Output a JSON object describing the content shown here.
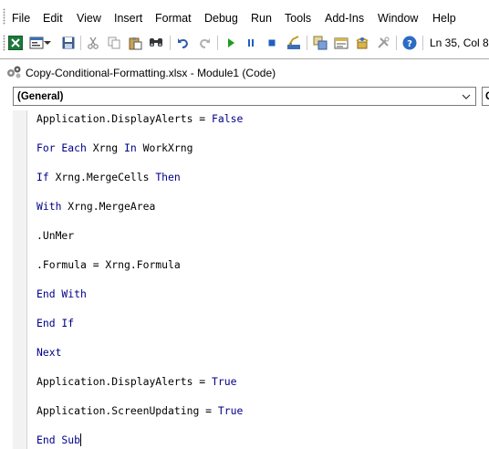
{
  "menu": [
    "File",
    "Edit",
    "View",
    "Insert",
    "Format",
    "Debug",
    "Run",
    "Tools",
    "Add-Ins",
    "Window",
    "Help"
  ],
  "toolbar": {
    "status": "Ln 35, Col 8",
    "icons": [
      "excel-icon",
      "insert-userform-icon",
      "dropdown-arrow-icon",
      "save-icon",
      "cut-icon",
      "copy-icon",
      "paste-icon",
      "find-icon",
      "undo-icon",
      "redo-icon",
      "run-icon",
      "break-icon",
      "reset-icon",
      "design-mode-icon",
      "project-explorer-icon",
      "properties-icon",
      "object-browser-icon",
      "toolbox-icon",
      "help-icon"
    ]
  },
  "window": {
    "title": "Copy-Conditional-Formatting.xlsx - Module1 (Code)",
    "object_combo": "(General)",
    "procedure_combo": "C"
  },
  "code": {
    "lines": [
      {
        "segments": [
          {
            "text": "Application.DisplayAlerts = ",
            "kw": false
          },
          {
            "text": "False",
            "kw": true
          }
        ]
      },
      {
        "segments": [
          {
            "text": "For Each",
            "kw": true
          },
          {
            "text": " Xrng ",
            "kw": false
          },
          {
            "text": "In",
            "kw": true
          },
          {
            "text": " WorkXrng",
            "kw": false
          }
        ]
      },
      {
        "segments": [
          {
            "text": "If",
            "kw": true
          },
          {
            "text": " Xrng.MergeCells ",
            "kw": false
          },
          {
            "text": "Then",
            "kw": true
          }
        ]
      },
      {
        "segments": [
          {
            "text": "With",
            "kw": true
          },
          {
            "text": " Xrng.MergeArea",
            "kw": false
          }
        ]
      },
      {
        "segments": [
          {
            "text": ".UnMer",
            "kw": false
          }
        ]
      },
      {
        "segments": [
          {
            "text": ".Formula = Xrng.Formula",
            "kw": false
          }
        ]
      },
      {
        "segments": [
          {
            "text": "End With",
            "kw": true
          }
        ]
      },
      {
        "segments": [
          {
            "text": "End If",
            "kw": true
          }
        ]
      },
      {
        "segments": [
          {
            "text": "Next",
            "kw": true
          }
        ]
      },
      {
        "segments": [
          {
            "text": "Application.DisplayAlerts = ",
            "kw": false
          },
          {
            "text": "True",
            "kw": true
          }
        ]
      },
      {
        "segments": [
          {
            "text": "Application.ScreenUpdating = ",
            "kw": false
          },
          {
            "text": "True",
            "kw": true
          }
        ]
      },
      {
        "segments": [
          {
            "text": "End Sub",
            "kw": true
          }
        ],
        "caret": true
      }
    ]
  },
  "colors": {
    "keyword": "#00008b",
    "text": "#000000",
    "run_icon": "#1e9e1e",
    "break_icon": "#1f5fbf"
  }
}
